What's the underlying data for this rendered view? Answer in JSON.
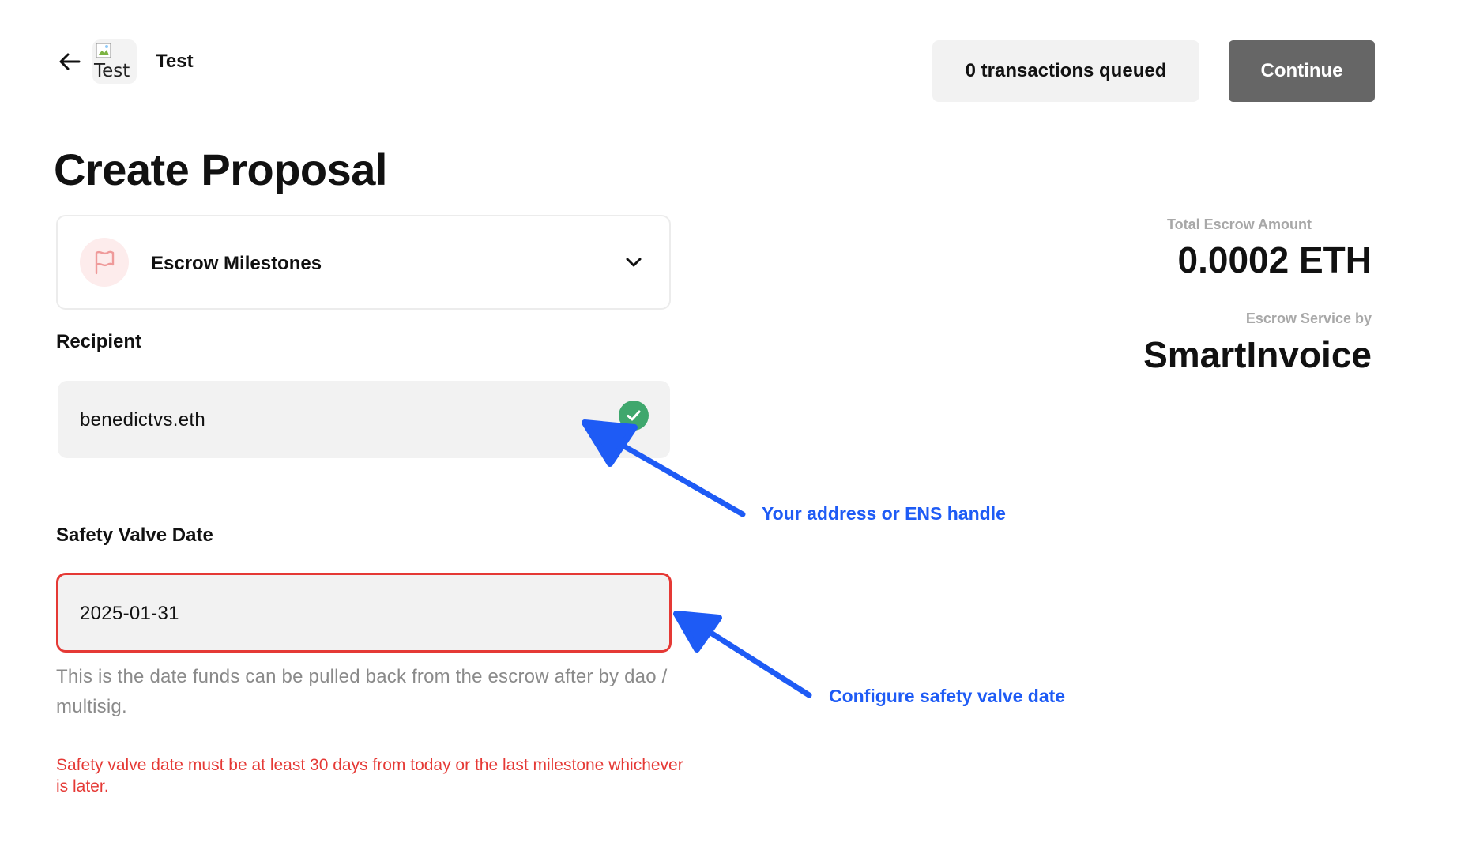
{
  "header": {
    "back_icon": "arrow-left-icon",
    "avatar_alt": "Test",
    "dao_name": "Test",
    "queue_label": "0 transactions queued",
    "continue_label": "Continue"
  },
  "page_title": "Create Proposal",
  "proposal_type": {
    "icon": "flag-icon",
    "label": "Escrow Milestones",
    "chevron_icon": "chevron-down-icon"
  },
  "recipient": {
    "label": "Recipient",
    "value": "benedictvs.eth",
    "status_icon": "check-circle-icon"
  },
  "safety_valve": {
    "label": "Safety Valve Date",
    "value": "2025-01-31",
    "helper": "This is the date funds can be pulled back from the escrow after by dao / multisig.",
    "error": "Safety valve date must be at least 30 days from today or the last milestone whichever is later."
  },
  "summary": {
    "total_label": "Total Escrow Amount",
    "total_value": "0.0002 ETH",
    "service_label": "Escrow Service by",
    "service_name": "SmartInvoice"
  },
  "annotations": {
    "recipient_note": "Your address or ENS handle",
    "date_note": "Configure safety valve date"
  },
  "colors": {
    "accent_gray": "#666666",
    "error_red": "#e53935",
    "success_green": "#3fa76d",
    "annotation_blue": "#1e5bf5",
    "flag_bg": "#fdecec",
    "flag_stroke": "#ef9a9a"
  }
}
